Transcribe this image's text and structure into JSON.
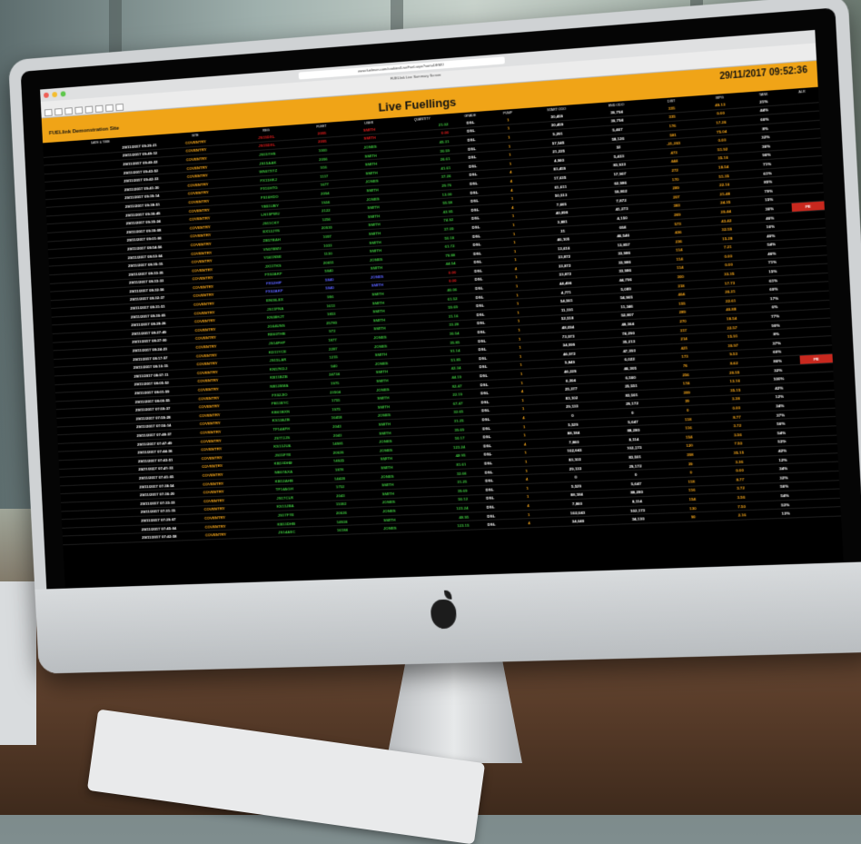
{
  "browser": {
    "url": "www.fuelmon.com/cookies/LiveFuel.aspx?sort=DEMO",
    "tab_title": "FUELlink Live Summary Screen"
  },
  "header": {
    "datetime": "29/11/2017 09:52:36",
    "page_title": "Live Fuellings",
    "site_name": "FUELlink Demonstration Site"
  },
  "colors": {
    "banner": "#f0a417",
    "site": "#f2a41b",
    "ok": "#3cbd3c",
    "alert": "#e21c1c",
    "flag": "#c8281e"
  },
  "table": {
    "columns": [
      "DATE & TIME",
      "SITE",
      "REG",
      "FLEET",
      "USER",
      "QUANTITY",
      "GRADE",
      "PUMP",
      "START ODO",
      "END ODO",
      "DIST",
      "MPG",
      "TANK",
      "ALR"
    ],
    "rows": [
      [
        "29/11/2017 09:20:21",
        "COVENTRY",
        "JS15DXL",
        "2095",
        "SMITH",
        "21.02",
        "DSL",
        "1",
        "30,459",
        "30,794",
        "335",
        "49.13",
        "21%",
        ""
      ],
      [
        "29/11/2017 09:49:12",
        "COVENTRY",
        "JS15DXL",
        "2095",
        "SMITH",
        "0.00",
        "DSL",
        "1",
        "30,459",
        "30,794",
        "335",
        "0.00",
        "44%",
        ""
      ],
      [
        "29/11/2017 09:40:22",
        "COVENTRY",
        "JS15YHS",
        "1000",
        "JONES",
        "45.31",
        "DSL",
        "1",
        "5,291",
        "5,467",
        "176",
        "17.26",
        "66%",
        ""
      ],
      [
        "29/11/2017 09:43:52",
        "COVENTRY",
        "JS15AAK",
        "2096",
        "SMITH",
        "30.59",
        "DSL",
        "1",
        "57,545",
        "58,126",
        "581",
        "75.04",
        "8%",
        ""
      ],
      [
        "29/11/2017 09:42:33",
        "COVENTRY",
        "WN07XYZ",
        "916",
        "SMITH",
        "26.61",
        "DSL",
        "1",
        "21,225",
        "32",
        "-21,203",
        "0.00",
        "32%",
        ""
      ],
      [
        "29/11/2017 09:41:30",
        "COVENTRY",
        "FX11HKJ",
        "1117",
        "SMITH",
        "41.61",
        "DSL",
        "1",
        "4,960",
        "5,433",
        "473",
        "51.92",
        "36%",
        ""
      ],
      [
        "29/11/2017 09:39:14",
        "COVENTRY",
        "FX10HTG",
        "1677",
        "JONES",
        "37.26",
        "DSL",
        "4",
        "83,459",
        "83,933",
        "444",
        "35.16",
        "96%",
        ""
      ],
      [
        "29/11/2017 09:38:51",
        "COVENTRY",
        "FS16HDO",
        "2094",
        "SMITH",
        "29.76",
        "DSL",
        "4",
        "17,635",
        "17,907",
        "272",
        "18.54",
        "71%",
        ""
      ],
      [
        "29/11/2017 09:36:45",
        "COVENTRY",
        "YB51UBY",
        "1924",
        "JONES",
        "13.00",
        "DSL",
        "4",
        "61,611",
        "62,986",
        "170",
        "51.35",
        "61%",
        ""
      ],
      [
        "29/11/2017 09:35:24",
        "COVENTRY",
        "LN15PWU",
        "2122",
        "SMITH",
        "55.58",
        "DSL",
        "1",
        "50,513",
        "50,802",
        "289",
        "22.16",
        "85%",
        ""
      ],
      [
        "29/11/2017 09:30:08",
        "COVENTRY",
        "JS11CKY",
        "1256",
        "SMITH",
        "43.95",
        "DSL",
        "4",
        "7,665",
        "7,872",
        "207",
        "21.48",
        "79%",
        ""
      ],
      [
        "29/11/2017 09:01:06",
        "COVENTRY",
        "EX12JYN",
        "20930",
        "SMITH",
        "74.92",
        "DSL",
        "1",
        "40,890",
        "41,273",
        "383",
        "24.35",
        "15%",
        ""
      ],
      [
        "29/11/2017 08:54:56",
        "COVENTRY",
        "ZB57BAH",
        "1097",
        "SMITH",
        "37.09",
        "DSL",
        "1",
        "3,881",
        "4,150",
        "269",
        "20.44",
        "36%",
        "FE"
      ],
      [
        "29/11/2017 08:53:04",
        "COVENTRY",
        "VN07BMV",
        "1033",
        "SMITH",
        "50.18",
        "DSL",
        "1",
        "31",
        "604",
        "573",
        "43.42",
        "46%",
        ""
      ],
      [
        "29/11/2017 08:35:15",
        "COVENTRY",
        "VG61NSE",
        "1130",
        "SMITH",
        "61.72",
        "DSL",
        "1",
        "46,105",
        "46,546",
        "436",
        "32.59",
        "16%",
        ""
      ],
      [
        "29/11/2017 08:33:35",
        "COVENTRY",
        "JX11TKS",
        "20651",
        "JONES",
        "78.88",
        "DSL",
        "1",
        "13,616",
        "13,857",
        "236",
        "15.28",
        "40%",
        ""
      ],
      [
        "29/11/2017 08:33:33",
        "COVENTRY",
        "FX02AKF",
        "5840",
        "SMITH",
        "44.54",
        "DSL",
        "1",
        "33,872",
        "33,986",
        "114",
        "7.21",
        "54%",
        ""
      ],
      [
        "29/11/2017 08:32:56",
        "COVENTRY",
        "FX52HIP",
        "5840",
        "JONES",
        "0.00",
        "DSL",
        "4",
        "33,872",
        "33,986",
        "114",
        "0.00",
        "46%",
        ""
      ],
      [
        "29/11/2017 08:32:37",
        "COVENTRY",
        "FX02AKF",
        "5840",
        "SMITH",
        "0.00",
        "DSL",
        "1",
        "33,872",
        "33,986",
        "114",
        "0.00",
        "71%",
        ""
      ],
      [
        "29/11/2017 08:31:51",
        "COVENTRY",
        "EN09LEX",
        "996",
        "SMITH",
        "40.06",
        "DSL",
        "1",
        "44,496",
        "44,796",
        "300",
        "33.35",
        "15%",
        ""
      ],
      [
        "29/11/2017 08:30:05",
        "COVENTRY",
        "JS11FNA",
        "1613",
        "SMITH",
        "61.52",
        "DSL",
        "1",
        "4,771",
        "5,089",
        "318",
        "17.73",
        "61%",
        ""
      ],
      [
        "29/11/2017 08:28:26",
        "COVENTRY",
        "KN08HJT",
        "1853",
        "SMITH",
        "59.69",
        "DSL",
        "1",
        "54,561",
        "54,965",
        "404",
        "26.21",
        "60%",
        ""
      ],
      [
        "29/11/2017 08:27:49",
        "COVENTRY",
        "JG64UNS",
        "25780",
        "SMITH",
        "31.16",
        "DSL",
        "1",
        "11,191",
        "11,346",
        "155",
        "22.61",
        "17%",
        ""
      ],
      [
        "29/11/2017 08:27:00",
        "COVENTRY",
        "RE60THB",
        "972",
        "SMITH",
        "33.28",
        "DSL",
        "1",
        "52,518",
        "52,807",
        "289",
        "40.88",
        "6%",
        ""
      ],
      [
        "29/11/2017 08:24:23",
        "COVENTRY",
        "JS14FHP",
        "1877",
        "JONES",
        "30.54",
        "DSL",
        "1",
        "48,094",
        "48,364",
        "270",
        "18.54",
        "77%",
        ""
      ],
      [
        "29/11/2017 08:17:57",
        "COVENTRY",
        "KD11YCE",
        "2287",
        "JONES",
        "35.85",
        "DSL",
        "1",
        "73,973",
        "74,290",
        "317",
        "22.57",
        "90%",
        ""
      ],
      [
        "29/11/2017 08:10:15",
        "COVENTRY",
        "JS15LAR",
        "1215",
        "SMITH",
        "91.14",
        "DSL",
        "1",
        "34,999",
        "35,213",
        "214",
        "15.91",
        "8%",
        ""
      ],
      [
        "29/11/2017 08:07:11",
        "COVENTRY",
        "KN57KDJ",
        "940",
        "JONES",
        "51.85",
        "DSL",
        "1",
        "46,972",
        "47,393",
        "421",
        "30.97",
        "37%",
        ""
      ],
      [
        "29/11/2017 08:05:52",
        "COVENTRY",
        "KB11BZB",
        "24734",
        "SMITH",
        "42.34",
        "DSL",
        "1",
        "5,849",
        "6,022",
        "173",
        "9.53",
        "60%",
        ""
      ],
      [
        "29/11/2017 08:01:59",
        "COVENTRY",
        "NB12BMA",
        "1975",
        "SMITH",
        "44.19",
        "DSL",
        "1",
        "46,229",
        "46,305",
        "76",
        "8.62",
        "86%",
        "FE"
      ],
      [
        "29/11/2017 08:00:55",
        "COVENTRY",
        "FX02JIO",
        "23504",
        "JONES",
        "82.47",
        "DSL",
        "1",
        "6,304",
        "6,560",
        "256",
        "20.55",
        "32%",
        ""
      ],
      [
        "29/11/2017 07:59:37",
        "COVENTRY",
        "FB13EYC",
        "1755",
        "SMITH",
        "22.19",
        "DSL",
        "4",
        "25,377",
        "25,551",
        "174",
        "13.16",
        "100%",
        ""
      ],
      [
        "29/11/2017 07:59:28",
        "COVENTRY",
        "KB61BXN",
        "1975",
        "SMITH",
        "67.47",
        "DSL",
        "1",
        "83,102",
        "83,501",
        "399",
        "35.15",
        "42%",
        ""
      ],
      [
        "29/11/2017 07:56:14",
        "COVENTRY",
        "KS12AZB",
        "16458",
        "JONES",
        "32.65",
        "DSL",
        "1",
        "29,133",
        "29,172",
        "39",
        "3.38",
        "12%",
        ""
      ],
      [
        "29/11/2017 07:48:37",
        "COVENTRY",
        "TF14AFH",
        "2043",
        "SMITH",
        "31.25",
        "DSL",
        "4",
        "0",
        "0",
        "0",
        "0.00",
        "34%",
        ""
      ],
      [
        "29/11/2017 07:47:49",
        "COVENTRY",
        "JS77JJS",
        "2043",
        "SMITH",
        "39.69",
        "DSL",
        "1",
        "5,529",
        "5,647",
        "118",
        "8.77",
        "37%",
        ""
      ],
      [
        "29/11/2017 07:44:36",
        "COVENTRY",
        "KS13JUA",
        "14981",
        "JONES",
        "50.17",
        "DSL",
        "1",
        "88,184",
        "88,280",
        "116",
        "3.72",
        "56%",
        ""
      ],
      [
        "29/11/2017 07:43:51",
        "COVENTRY",
        "JS15FYE",
        "20626",
        "JONES",
        "123.24",
        "DSL",
        "4",
        "7,860",
        "8,114",
        "154",
        "3.56",
        "54%",
        ""
      ],
      [
        "29/11/2017 07:41:33",
        "COVENTRY",
        "KB13DHB",
        "14925",
        "SMITH",
        "48.95",
        "DSL",
        "1",
        "102,043",
        "102,173",
        "130",
        "7.50",
        "53%",
        ""
      ],
      [
        "29/11/2017 07:41:05",
        "COVENTRY",
        "NB07AXA",
        "1878",
        "SMITH",
        "81.61",
        "DSL",
        "1",
        "83,103",
        "83,501",
        "398",
        "35.15",
        "42%",
        ""
      ],
      [
        "29/11/2017 07:38:54",
        "COVENTRY",
        "KB12AHB",
        "14428",
        "JONES",
        "32.66",
        "DSL",
        "1",
        "29,133",
        "29,172",
        "39",
        "3.36",
        "12%",
        ""
      ],
      [
        "29/11/2017 07:36:20",
        "COVENTRY",
        "TF14AGH",
        "1752",
        "SMITH",
        "31.25",
        "DSL",
        "4",
        "0",
        "0",
        "0",
        "0.00",
        "34%",
        ""
      ],
      [
        "29/11/2017 07:33:33",
        "COVENTRY",
        "JS17CLR",
        "2043",
        "SMITH",
        "39.69",
        "DSL",
        "1",
        "5,529",
        "5,647",
        "118",
        "8.77",
        "32%",
        ""
      ],
      [
        "29/11/2017 07:31:15",
        "COVENTRY",
        "KS13JBA",
        "11082",
        "JONES",
        "50.12",
        "DSL",
        "1",
        "88,184",
        "88,280",
        "116",
        "3.72",
        "56%",
        ""
      ],
      [
        "29/11/2017 07:29:07",
        "COVENTRY",
        "JS17FYE",
        "20626",
        "JONES",
        "123.24",
        "DSL",
        "4",
        "7,860",
        "8,114",
        "154",
        "3.56",
        "54%",
        ""
      ],
      [
        "29/11/2017 07:45:04",
        "COVENTRY",
        "KB13DHB",
        "14924",
        "SMITH",
        "48.95",
        "DSL",
        "1",
        "102,043",
        "102,173",
        "130",
        "7.50",
        "53%",
        ""
      ],
      [
        "29/11/2017 07:42:58",
        "COVENTRY",
        "JS14AEC",
        "16184",
        "JONES",
        "123.15",
        "DSL",
        "4",
        "34,040",
        "34,130",
        "90",
        "2.16",
        "13%",
        ""
      ]
    ],
    "highlight_rows": {
      "red": [
        0,
        1
      ],
      "blue": [
        17,
        18
      ]
    }
  }
}
